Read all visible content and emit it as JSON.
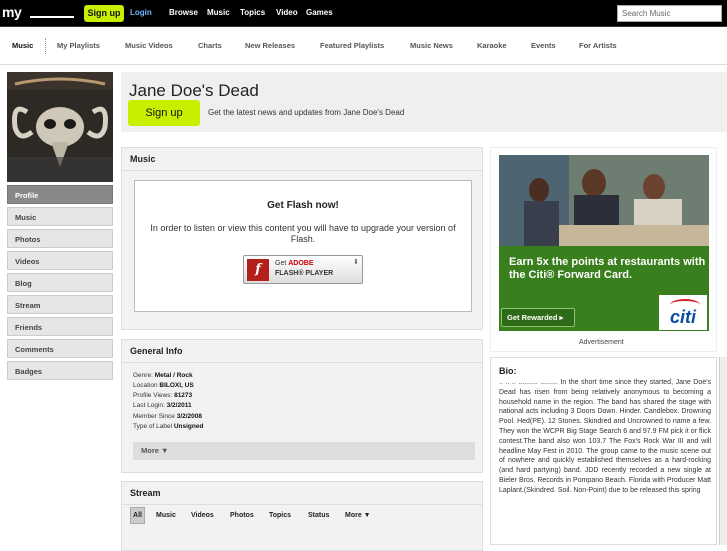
{
  "topbar": {
    "logo": "my",
    "signup": "Sign up",
    "login": "Login",
    "nav": [
      "Browse",
      "Music",
      "Topics",
      "Video",
      "Games"
    ],
    "search_placeholder": "Search Music"
  },
  "subnav": [
    "Music",
    "My Playlists",
    "Music Videos",
    "Charts",
    "New Releases",
    "Featured Playlists",
    "Music News",
    "Karaoke",
    "Events",
    "For Artists"
  ],
  "sidebar": [
    "Profile",
    "Music",
    "Photos",
    "Videos",
    "Blog",
    "Stream",
    "Friends",
    "Comments",
    "Badges"
  ],
  "header": {
    "artist_name": "Jane Doe's Dead",
    "signup": "Sign up",
    "tagline": "Get the latest news and updates from Jane Doe's Dead"
  },
  "music_panel": {
    "title": "Music",
    "flash_title": "Get Flash now!",
    "flash_message": "In order to listen or view this content you will have to upgrade your version of Flash.",
    "flash_button_get": "Get",
    "flash_button_adobe": "ADOBE",
    "flash_button_player": "FLASH® PLAYER"
  },
  "general_info": {
    "title": "General Info",
    "rows": [
      {
        "label": "Genre:",
        "value": "Metal / Rock"
      },
      {
        "label": "Location",
        "value": "BILOXI, US"
      },
      {
        "label": "Profile Views:",
        "value": "81273"
      },
      {
        "label": "Last Login:",
        "value": "3/2/2011"
      },
      {
        "label": "Member Since",
        "value": "3/2/2008"
      },
      {
        "label": "Type of Label",
        "value": "Unsigned"
      }
    ],
    "more": "More ▼"
  },
  "stream": {
    "title": "Stream",
    "tabs": [
      "All",
      "Music",
      "Videos",
      "Photos",
      "Topics",
      "Status",
      "More ▼"
    ]
  },
  "ad": {
    "headline": "Earn 5x the points at restaurants with the Citi® Forward Card.",
    "button": "Get Rewarded ▸",
    "brand": "citi",
    "label": "Advertisement"
  },
  "bio": {
    "title": "Bio:",
    "text": ".. .. .. .......... ......... In the short time since they started, Jane Doe's Dead has risen from being relatively anonymous to becoming a household name in the region. The band has shared the stage with national acts including 3 Doors Down. Hinder. Candlebox. Drowning Pool. Hed(PE). 12 Stones. Skindred and Uncrowned to name a few. They won the WCPR Big Stage Search 6 and 97.9 FM pick it or flick contest.The band also won 103.7 The Fox's Rock War III and will headline May Fest in 2010. The group came to the music scene out of nowhere and quickly established themselves as a hard-rocking (and hard partying) band. JDD recently recorded a new single at Bieler Bros. Records in Pompano Beach. Florida with Producer Matt Laplant.(Skindred. Soil. Non-Point) due to be released this spring"
  }
}
